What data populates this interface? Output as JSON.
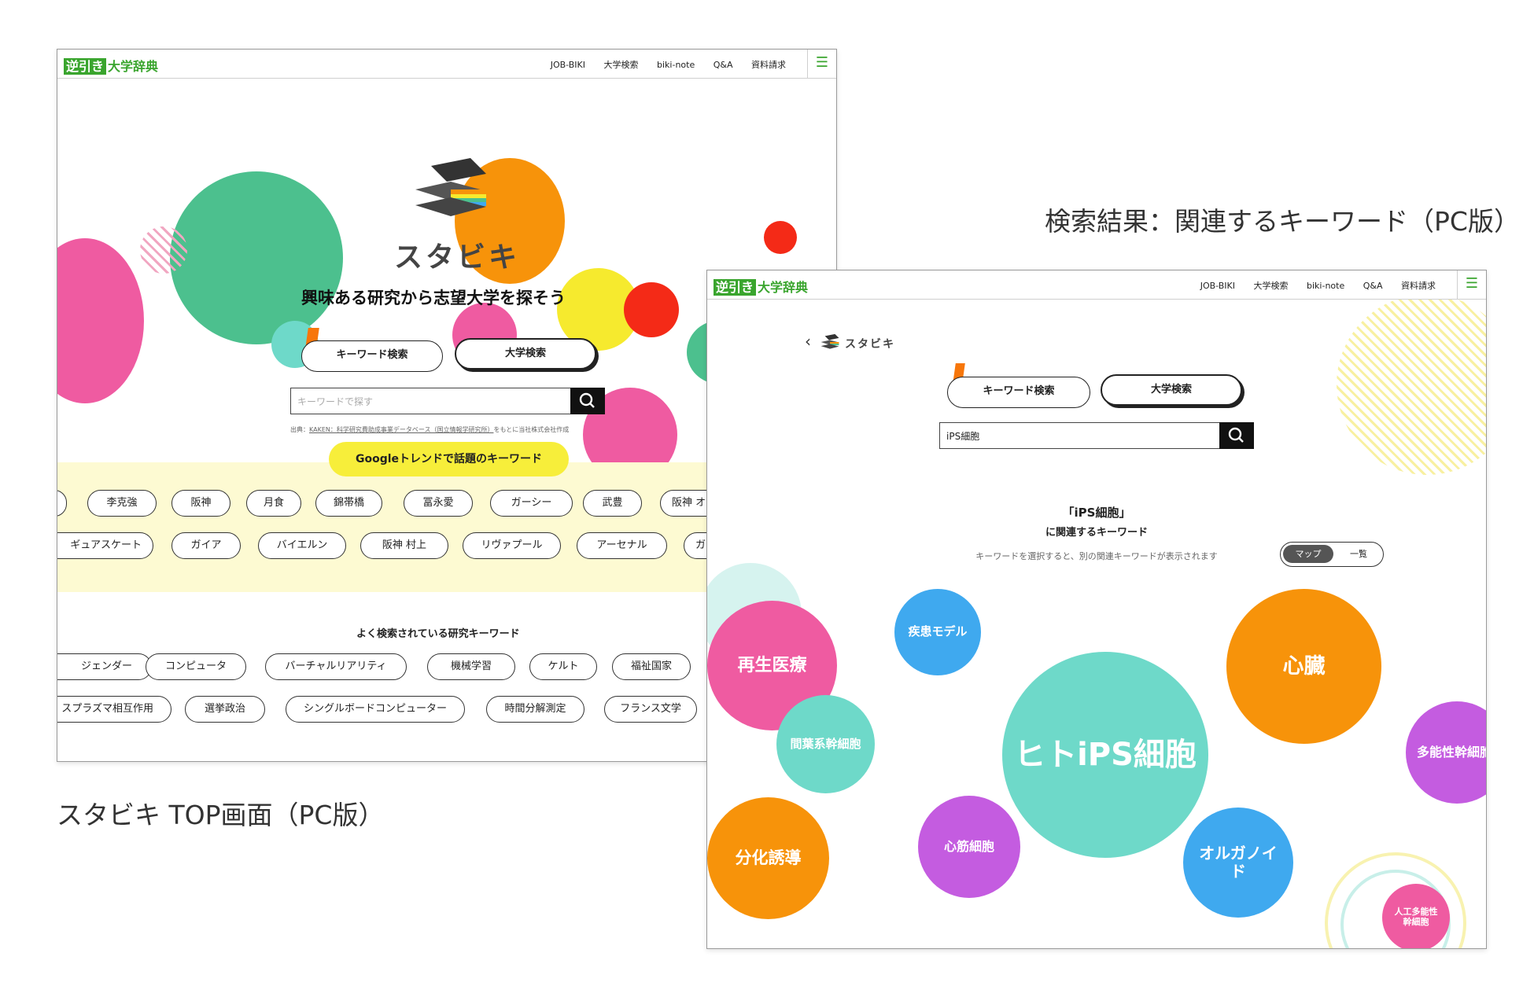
{
  "captions": {
    "top": "スタビキ TOP画面（PC版）",
    "result": "検索結果：関連するキーワード（PC版）"
  },
  "header": {
    "logo_box": "逆引き",
    "logo_text": "大学辞典",
    "nav": [
      "JOB-BIKI",
      "大学検索",
      "biki-note",
      "Q&A",
      "資料請求"
    ],
    "menu_icon": "hamburger-icon"
  },
  "top": {
    "brand": "スタビキ",
    "tagline": "興味ある研究から志望大学を探そう",
    "tabs": {
      "keyword": "キーワード検索",
      "university": "大学検索"
    },
    "search_placeholder": "キーワードで探す",
    "source_prefix": "出典：",
    "source_link": "KAKEN：科学研究費助成事業データベース（国立情報学研究所）",
    "source_suffix": "をもとに当社株式会社作成",
    "trend_button": "Googleトレンドで話題のキーワード",
    "trend_row1": [
      "李克強",
      "阪神",
      "月食",
      "錦帯橋",
      "冨永愛",
      "ガーシー",
      "武豊",
      "阪神 オ"
    ],
    "trend_row2": [
      "ギュアスケート",
      "ガイア",
      "バイエルン",
      "阪神 村上",
      "リヴァプール",
      "アーセナル",
      "ガ"
    ],
    "popular_title": "よく検索されている研究キーワード",
    "popular_row1": [
      "ジェンダー",
      "コンピュータ",
      "バーチャルリアリティ",
      "機械学習",
      "ケルト",
      "福祉国家"
    ],
    "popular_row2": [
      "スプラズマ相互作用",
      "選挙政治",
      "シングルボードコンピューター",
      "時間分解測定",
      "フランス文学"
    ]
  },
  "result": {
    "back_icon": "chevron-left-icon",
    "brand": "スタビキ",
    "tabs": {
      "keyword": "キーワード検索",
      "university": "大学検索"
    },
    "search_value": "iPS細胞",
    "heading_main": "「iPS細胞」",
    "heading_sub": "に関連するキーワード",
    "hint": "キーワードを選択すると、別の関連キーワードが表示されます",
    "toggle": {
      "map": "マップ",
      "list": "一覧",
      "selected": "マップ"
    },
    "bubbles": {
      "regen": "再生医療",
      "disease": "疾患モデル",
      "mesen": "間葉系幹細胞",
      "center": "ヒトiPS細胞",
      "heart": "心臓",
      "pluri": "多能性幹細胞",
      "diff": "分化誘導",
      "cardio": "心筋細胞",
      "organoid": "オルガノイド",
      "artificial": "人工多能性幹細胞"
    },
    "colors": {
      "pink": "#ef5ba1",
      "blue": "#3fa9ef",
      "teal": "#6ed9c9",
      "orange": "#f7930a",
      "purple": "#c45ce0"
    }
  }
}
